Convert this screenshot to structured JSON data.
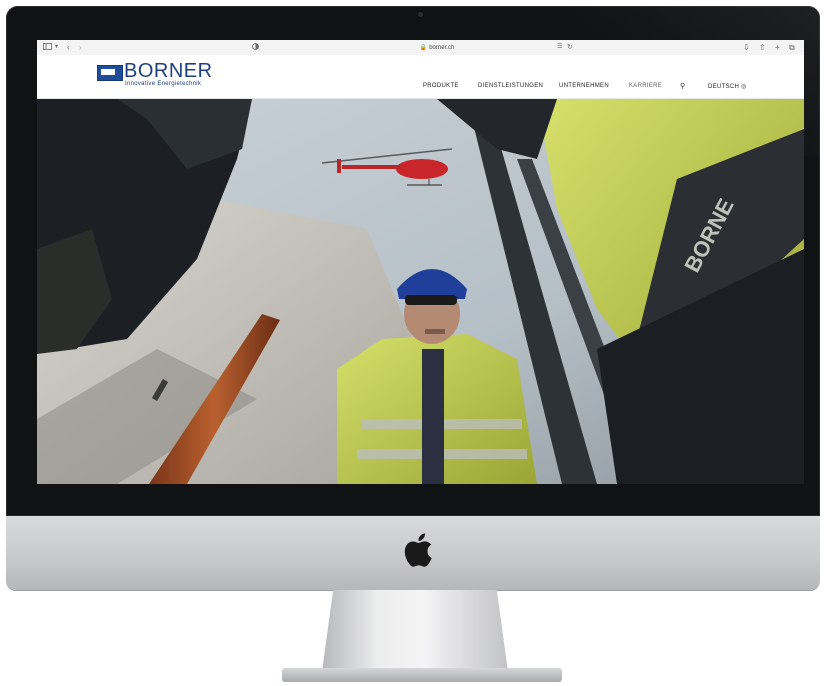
{
  "browser": {
    "url": "borner.ch",
    "icons": [
      "sidebar-icon",
      "chevron-down-icon",
      "back-icon",
      "forward-icon",
      "shield-icon",
      "lock-icon",
      "translate-icon",
      "reload-icon",
      "download-icon",
      "share-icon",
      "plus-icon",
      "tabs-icon"
    ]
  },
  "site": {
    "logo_text": "BORNER",
    "tagline": "Innovative Energietechnik",
    "nav": {
      "products": "PRODUKTE",
      "services": "DIENSTLEISTUNGEN",
      "company": "UNTERNEHMEN",
      "careers": "KARRIERE",
      "language": "DEUTSCH"
    },
    "colors": {
      "brand": "#1f4d9a",
      "jacket": "#c7d64a"
    }
  }
}
